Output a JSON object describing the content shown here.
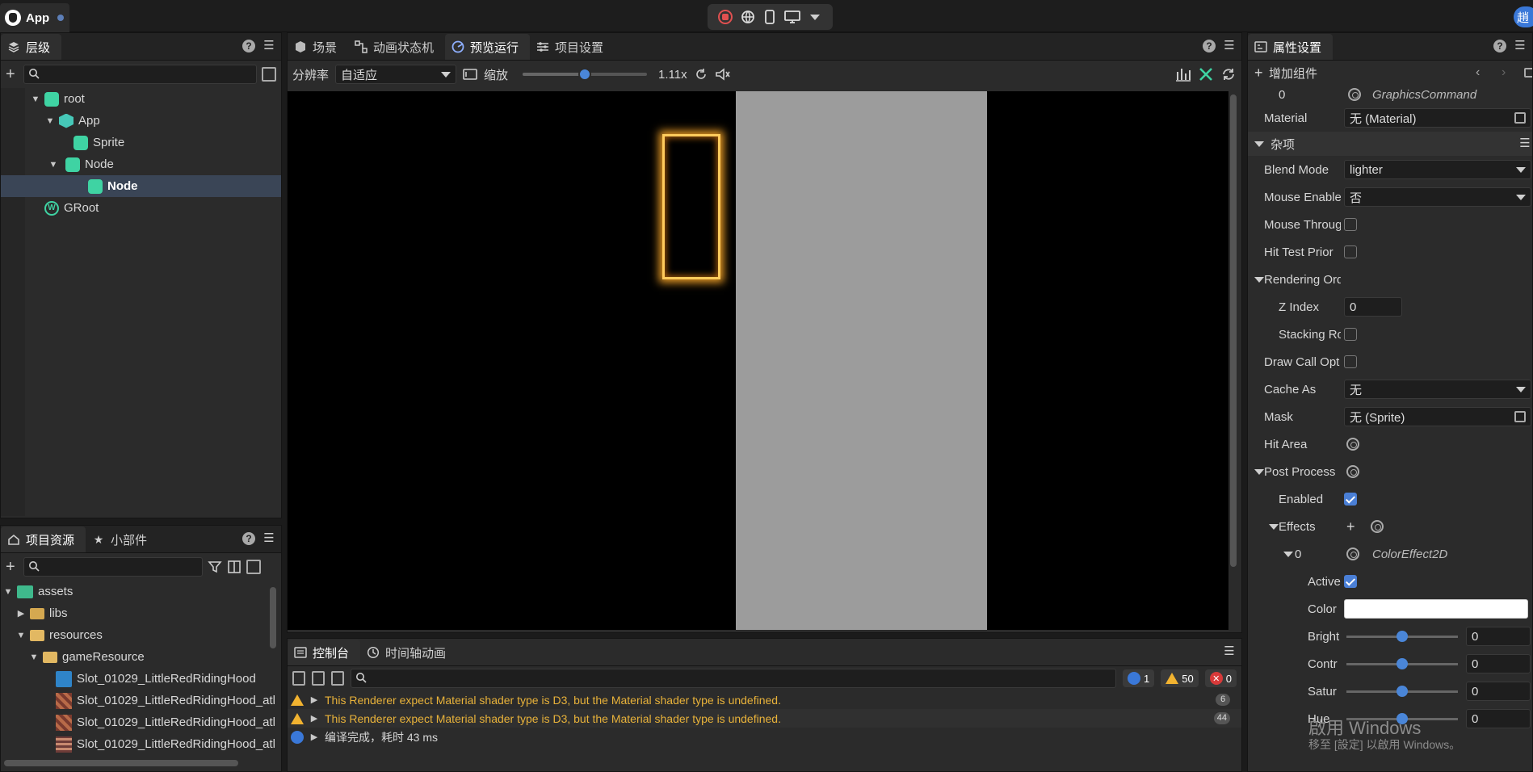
{
  "app": {
    "title": "App",
    "user_initial": "趙"
  },
  "hierarchy": {
    "tab": "层级",
    "tree": [
      {
        "label": "root",
        "level": 0
      },
      {
        "label": "App",
        "level": 1
      },
      {
        "label": "Sprite",
        "level": 2
      },
      {
        "label": "Node",
        "level": 2
      },
      {
        "label": "Node",
        "level": 3,
        "selected": true
      },
      {
        "label": "GRoot",
        "level": 0
      }
    ]
  },
  "assets": {
    "tabs": [
      "项目资源",
      "小部件"
    ],
    "items": [
      {
        "label": "assets"
      },
      {
        "label": "libs"
      },
      {
        "label": "resources"
      },
      {
        "label": "gameResource"
      },
      {
        "label": "Slot_01029_LittleRedRidingHood"
      },
      {
        "label": "Slot_01029_LittleRedRidingHood_atl"
      },
      {
        "label": "Slot_01029_LittleRedRidingHood_atl"
      },
      {
        "label": "Slot_01029_LittleRedRidingHood_atl"
      }
    ]
  },
  "center": {
    "tabs": [
      "场景",
      "动画状态机",
      "预览运行",
      "项目设置"
    ],
    "toolbar": {
      "resolution_label": "分辨率",
      "resolution_value": "自适应",
      "zoom_label": "缩放",
      "zoom_value": "1.11x",
      "zoom_fraction": 0.5
    }
  },
  "console": {
    "tabs": [
      "控制台",
      "时间轴动画"
    ],
    "badges": {
      "info": "1",
      "warn": "50",
      "error": "0"
    },
    "logs": [
      {
        "text": "This Renderer expect Material shader type is D3, but the Material shader type is undefined.",
        "count": "6",
        "type": "warn"
      },
      {
        "text": "This Renderer expect Material shader type is D3, but the Material shader type is undefined.",
        "count": "44",
        "type": "warn"
      },
      {
        "text": "编译完成，耗时 43 ms",
        "type": "info"
      }
    ]
  },
  "inspector": {
    "tab": "属性设置",
    "add_component": "增加组件",
    "rows": {
      "index0": "0",
      "graphics_command": "GraphicsCommand",
      "material_label": "Material",
      "material_value": "无 (Material)",
      "misc_section": "杂项",
      "blend_label": "Blend Mode",
      "blend_value": "lighter",
      "mouse_enable_label": "Mouse Enable",
      "mouse_enable_value": "否",
      "mouse_through_label": "Mouse Throug",
      "hit_test_label": "Hit Test Prior",
      "rendering_label": "Rendering Ord",
      "zindex_label": "Z Index",
      "zindex_value": "0",
      "stacking_label": "Stacking Ro",
      "drawcall_label": "Draw Call Opt",
      "cacheas_label": "Cache As",
      "cacheas_value": "无",
      "mask_label": "Mask",
      "mask_value": "无 (Sprite)",
      "hitarea_label": "Hit Area",
      "postprocess_label": "Post Process",
      "enabled_label": "Enabled",
      "effects_label": "Effects",
      "effect0_index": "0",
      "effect0_name": "ColorEffect2D",
      "active_label": "Active",
      "color_label": "Color",
      "bright_label": "Bright",
      "bright_value": "0",
      "contr_label": "Contr",
      "contr_value": "0",
      "satur_label": "Satur",
      "satur_value": "0",
      "hue_label": "Hue",
      "hue_value": "0"
    }
  },
  "watermark": {
    "line1": "啟用 Windows",
    "line2": "移至 [設定] 以啟用 Windows。"
  }
}
